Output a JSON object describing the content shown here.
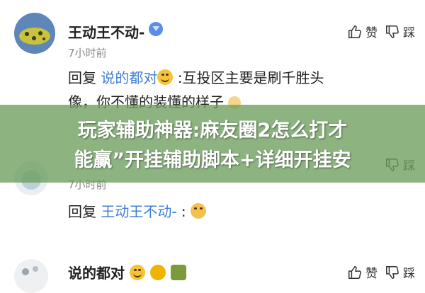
{
  "comments": [
    {
      "username": "王动王不动-",
      "time": "7小时前",
      "like_label": "赞",
      "dislike_label": "踩",
      "reply_prefix": "回复",
      "reply_to": "说的都对",
      "reply_body_1": " :互投区主要是刷千胜头",
      "reply_body_2": "像，你不懂的装懂的样子"
    },
    {
      "time": "7小时前",
      "like_label": "赞",
      "dislike_label": "踩",
      "reply_prefix": "回复",
      "reply_to": "王动王不动-",
      "reply_body": " :"
    },
    {
      "username": "说的都对",
      "like_label": "赞",
      "dislike_label": "踩"
    }
  ],
  "banner": {
    "line1": "玩家辅助神器:麻友圈2怎么打才",
    "line2": "能赢”开挂辅助脚本+详细开挂安"
  },
  "colors": {
    "mention": "#3f7fd6",
    "banner": "#6c9e5c"
  }
}
